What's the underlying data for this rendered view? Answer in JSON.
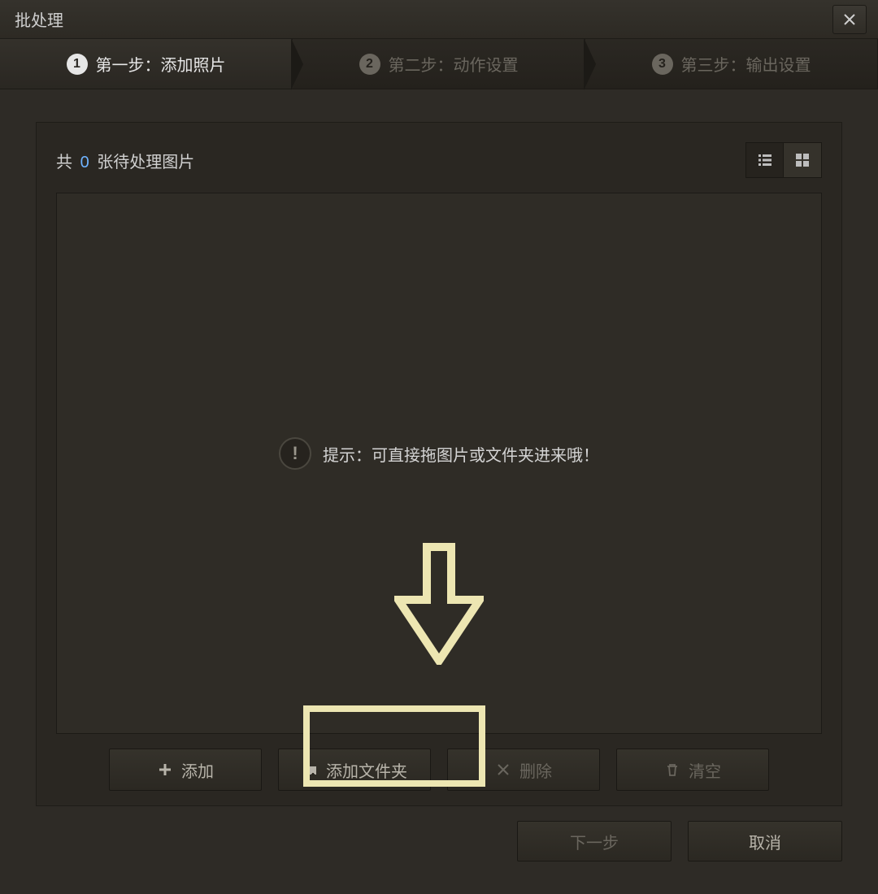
{
  "window": {
    "title": "批处理"
  },
  "steps": [
    {
      "num": "1",
      "label": "第一步：添加照片",
      "active": true
    },
    {
      "num": "2",
      "label": "第二步：动作设置",
      "active": false
    },
    {
      "num": "3",
      "label": "第三步：输出设置",
      "active": false
    }
  ],
  "counter": {
    "prefix": "共",
    "value": "0",
    "suffix": "张待处理图片"
  },
  "hint": {
    "text": "提示：可直接拖图片或文件夹进来哦！"
  },
  "actions": {
    "add": "添加",
    "add_folder": "添加文件夹",
    "delete": "删除",
    "clear": "清空"
  },
  "footer": {
    "next": "下一步",
    "cancel": "取消"
  }
}
